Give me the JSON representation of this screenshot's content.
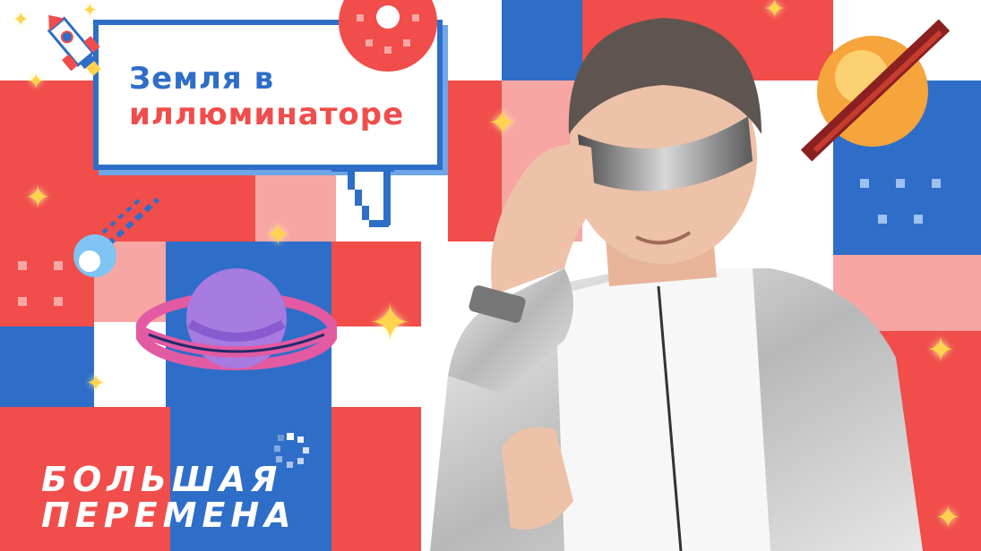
{
  "bubble": {
    "title_line1": "Земля в",
    "title_line2": "иллюминаторе"
  },
  "brand": {
    "line1": "БОЛЬШАЯ",
    "line2": "ПЕРЕМЕНА"
  },
  "colors": {
    "red": "#f04d4b",
    "blue": "#2e6ec8",
    "light_blue": "#6fa6e8",
    "pink": "#f7a6a3",
    "yellow": "#ffd34d"
  },
  "icons": {
    "rocket": "rocket-icon",
    "purple_planet": "planet-icon",
    "orange_planet": "planet-icon",
    "comet": "comet-icon",
    "sparkle": "sparkle-icon"
  }
}
